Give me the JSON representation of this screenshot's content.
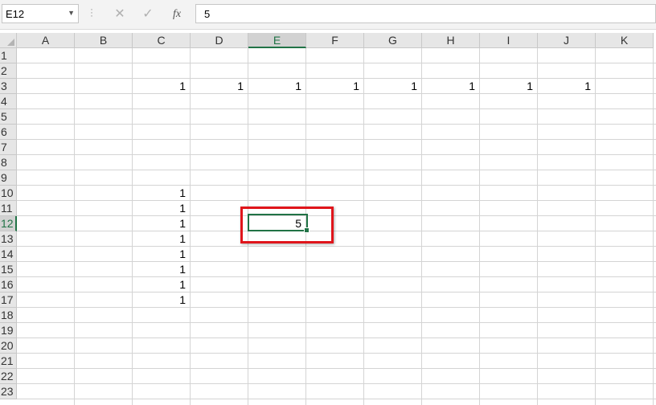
{
  "formula_bar": {
    "name_box": "E12",
    "cancel_icon": "✕",
    "enter_icon": "✓",
    "function_icon": "fx",
    "formula_value": "5"
  },
  "sheet": {
    "columns": [
      "A",
      "B",
      "C",
      "D",
      "E",
      "F",
      "G",
      "H",
      "I",
      "J",
      "K"
    ],
    "rows": [
      "1",
      "2",
      "3",
      "4",
      "5",
      "6",
      "7",
      "8",
      "9",
      "10",
      "11",
      "12",
      "13",
      "14",
      "15",
      "16",
      "17",
      "18",
      "19",
      "20",
      "21",
      "22",
      "23"
    ],
    "selected_column": "E",
    "selected_row": "12",
    "cells": [
      {
        "ref": "C3",
        "value": "1"
      },
      {
        "ref": "D3",
        "value": "1"
      },
      {
        "ref": "E3",
        "value": "1"
      },
      {
        "ref": "F3",
        "value": "1"
      },
      {
        "ref": "G3",
        "value": "1"
      },
      {
        "ref": "H3",
        "value": "1"
      },
      {
        "ref": "I3",
        "value": "1"
      },
      {
        "ref": "J3",
        "value": "1"
      },
      {
        "ref": "C10",
        "value": "1"
      },
      {
        "ref": "C11",
        "value": "1"
      },
      {
        "ref": "C12",
        "value": "1"
      },
      {
        "ref": "C13",
        "value": "1"
      },
      {
        "ref": "C14",
        "value": "1"
      },
      {
        "ref": "C15",
        "value": "1"
      },
      {
        "ref": "C16",
        "value": "1"
      },
      {
        "ref": "C17",
        "value": "1"
      },
      {
        "ref": "E12",
        "value": "5"
      }
    ]
  },
  "colors": {
    "accent": "#217346",
    "highlight": "#e0151b"
  }
}
